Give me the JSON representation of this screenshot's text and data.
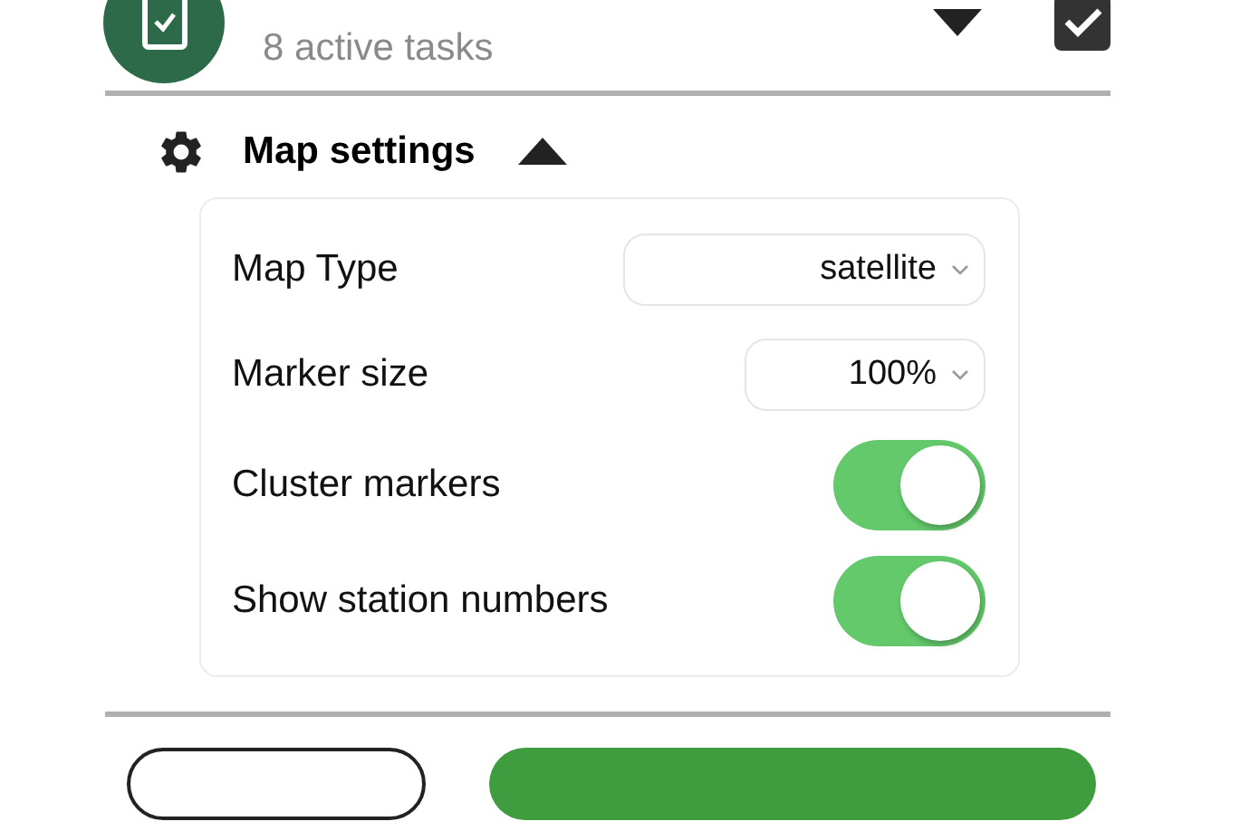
{
  "task_group": {
    "subtitle": "8 active tasks",
    "expanded": false,
    "checked": true
  },
  "map_settings": {
    "title": "Map settings",
    "expanded": true,
    "rows": [
      {
        "kind": "select",
        "label": "Map Type",
        "value": "satellite"
      },
      {
        "kind": "select",
        "label": "Marker size",
        "value": "100%"
      },
      {
        "kind": "toggle",
        "label": "Cluster markers",
        "on": true
      },
      {
        "kind": "toggle",
        "label": "Show station numbers",
        "on": true
      }
    ]
  }
}
